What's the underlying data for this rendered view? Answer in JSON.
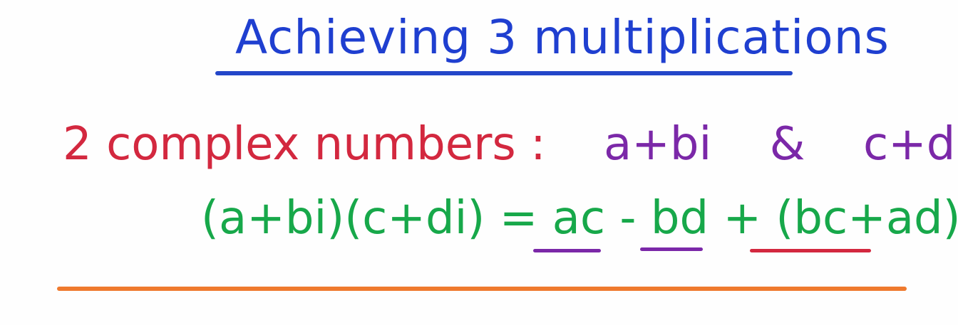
{
  "title": "Achieving 3 multiplications",
  "line_complex_numbers": {
    "label": "2 complex numbers :",
    "first": "a+bi",
    "ampersand": "&",
    "second": "c+di"
  },
  "equation": "(a+bi)(c+di) = ac - bd + (bc+ad) i",
  "colors": {
    "title": "#1f3fd0",
    "label": "#d3283f",
    "complex_numbers": "#7b28a8",
    "equation": "#17a84a",
    "underline_ac_bd": "#7b28a8",
    "underline_imag": "#d3283f",
    "bottom_rule": "#ef7a2e"
  }
}
